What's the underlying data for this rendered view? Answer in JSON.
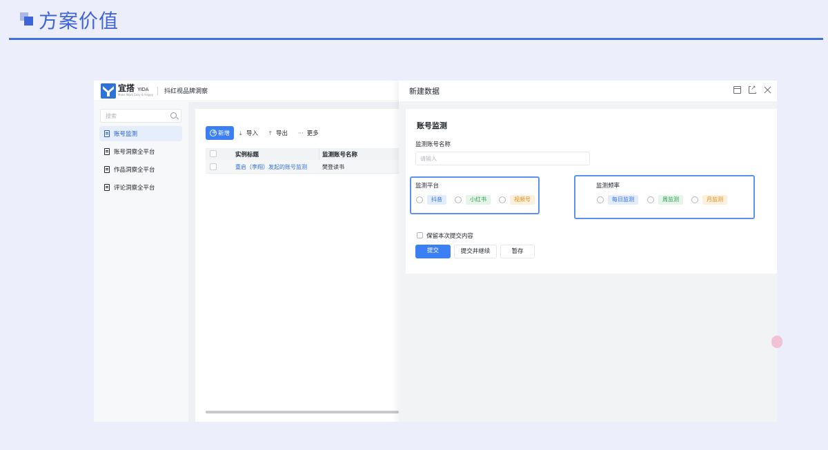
{
  "slide": {
    "title": "方案价值"
  },
  "app": {
    "logo": {
      "name": "宜搭",
      "name_en": "YIDA",
      "tagline": "Make Work Easy & Happy"
    },
    "app_name": "抖红视品牌洞察",
    "sidebar": {
      "search_placeholder": "搜索",
      "items": [
        {
          "label": "账号监测",
          "active": true
        },
        {
          "label": "账号洞察全平台",
          "active": false
        },
        {
          "label": "作品洞察全平台",
          "active": false
        },
        {
          "label": "评论洞察全平台",
          "active": false
        }
      ]
    },
    "toolbar": {
      "new_label": "新增",
      "import_label": "导入",
      "export_label": "导出",
      "more_label": "更多"
    },
    "table": {
      "columns": [
        "实例标题",
        "监测账号名称"
      ],
      "rows": [
        {
          "title": "重启（李翔）发起的账号监测",
          "account": "樊登读书"
        }
      ]
    }
  },
  "drawer": {
    "title": "新建数据",
    "form": {
      "title": "账号监测",
      "account_label": "监测账号名称",
      "account_placeholder": "请输入",
      "platform": {
        "label": "监测平台",
        "options": [
          "抖音",
          "小红书",
          "视频号"
        ]
      },
      "frequency": {
        "label": "监测频率",
        "options": [
          "每日监测",
          "周监测",
          "月监测"
        ]
      },
      "keep_label": "保留本次提交内容",
      "submit_label": "提交",
      "submit_continue_label": "提交并继续",
      "save_draft_label": "暂存"
    }
  },
  "colors": {
    "accent": "#3b7ff5",
    "slide_blue": "#3f63d8",
    "highlight_border": "#5b8ff0"
  }
}
